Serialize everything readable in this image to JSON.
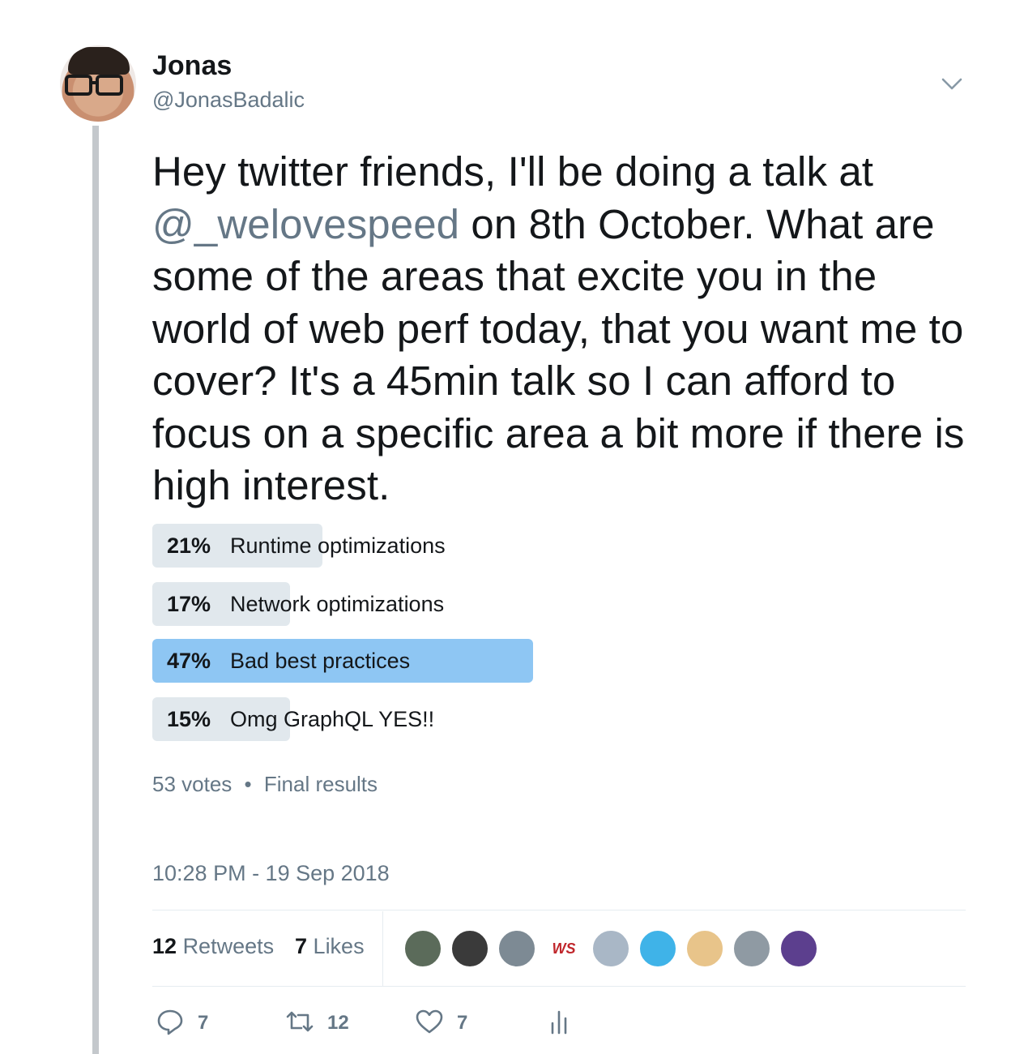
{
  "author": {
    "name": "Jonas",
    "handle": "@JonasBadalic"
  },
  "tweet": {
    "text_before": "Hey twitter friends, I'll be doing a talk at ",
    "mention": "@_welovespeed",
    "text_after": " on 8th October. What are some of the areas that excite you in the world of web perf today, that you want me to cover? It's a 45min talk so I can afford to focus on a specific area a bit more if there is high interest."
  },
  "poll": {
    "options": [
      {
        "percent": 21,
        "percent_label": "21%",
        "label": "Runtime optimizations",
        "winner": false
      },
      {
        "percent": 17,
        "percent_label": "17%",
        "label": "Network optimizations",
        "winner": false
      },
      {
        "percent": 47,
        "percent_label": "47%",
        "label": "Bad best practices",
        "winner": true
      },
      {
        "percent": 15,
        "percent_label": "15%",
        "label": "Omg GraphQL YES!!",
        "winner": false
      }
    ],
    "votes": "53 votes",
    "separator": "•",
    "status": "Final results"
  },
  "timestamp": "10:28 PM - 19 Sep 2018",
  "stats": {
    "retweets_count": "12",
    "retweets_label": "Retweets",
    "likes_count": "7",
    "likes_label": "Likes"
  },
  "likers": [
    {
      "bg": "#5b6b5a",
      "fg": "#ffffff",
      "text": ""
    },
    {
      "bg": "#3a3a3a",
      "fg": "#ffffff",
      "text": ""
    },
    {
      "bg": "#7d8a94",
      "fg": "#ffffff",
      "text": ""
    },
    {
      "bg": "#ffffff",
      "fg": "#c0262b",
      "text": "WS"
    },
    {
      "bg": "#a9b7c6",
      "fg": "#ffffff",
      "text": ""
    },
    {
      "bg": "#3fb3e8",
      "fg": "#ffffff",
      "text": ""
    },
    {
      "bg": "#e8c48a",
      "fg": "#ffffff",
      "text": ""
    },
    {
      "bg": "#8f9aa3",
      "fg": "#ffffff",
      "text": ""
    },
    {
      "bg": "#5c3f8e",
      "fg": "#ffffff",
      "text": ""
    }
  ],
  "actions": {
    "reply_count": "7",
    "retweet_count": "12",
    "like_count": "7"
  },
  "icons": {
    "caret": "chevron-down-icon",
    "reply": "reply-icon",
    "retweet": "retweet-icon",
    "like": "heart-icon",
    "analytics": "analytics-icon"
  }
}
